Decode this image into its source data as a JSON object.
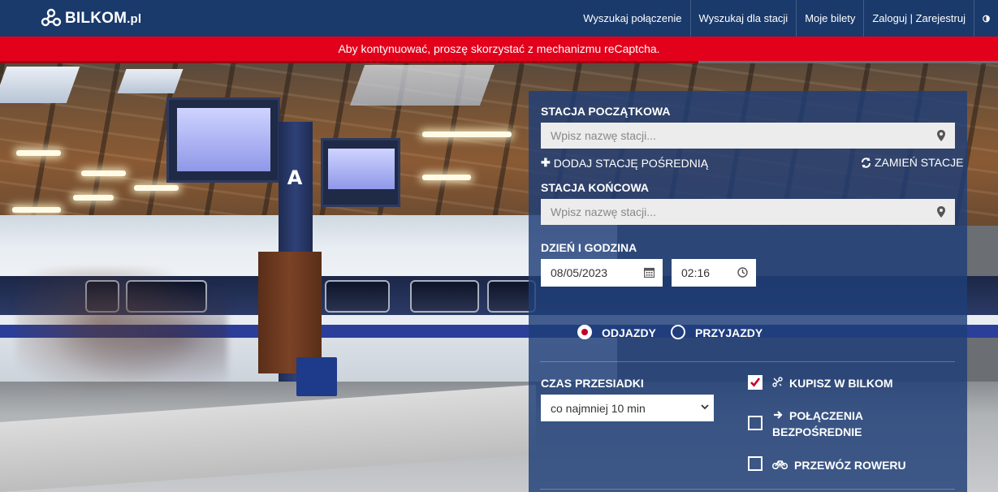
{
  "header": {
    "logo_name": "BILKOM",
    "logo_suffix": ".pl",
    "nav": [
      "Wyszukaj połączenie",
      "Wyszukaj dla stacji",
      "Moje bilety",
      "Zaloguj | Zarejestruj"
    ],
    "contrast_icon": "contrast-icon"
  },
  "alert": {
    "message": "Aby kontynuować, proszę skorzystać z mechanizmu reCaptcha."
  },
  "search": {
    "from_label": "Stacja początkowa",
    "from_placeholder": "Wpisz nazwę stacji...",
    "add_via_label": "Dodaj stację pośrednią",
    "swap_label": "Zamień stacje",
    "to_label": "Stacja końcowa",
    "to_placeholder": "Wpisz nazwę stacji...",
    "datetime_label": "Dzień i godzina",
    "date_value": "08/05/2023",
    "time_value": "02:16",
    "departures_label": "ODJAZDY",
    "arrivals_label": "PRZYJAZDY",
    "selected_direction": "departures",
    "transfer_label": "Czas przesiadki",
    "transfer_value": "co najmniej 10 min",
    "options": [
      {
        "label": "Kupisz w BILKOM",
        "checked": true,
        "icon": "ticket-icon"
      },
      {
        "label_line1": "Połączenia",
        "label_line2": "bezpośrednie",
        "checked": false,
        "icon": "arrow-right-icon"
      },
      {
        "label": "Przewóz roweru",
        "checked": false,
        "icon": "bicycle-icon"
      }
    ]
  },
  "background": {
    "platform_sign": "A"
  },
  "colors": {
    "header_bg": "#1a3a6b",
    "alert_bg": "#e3001b",
    "panel_bg": "#1e3e78",
    "accent_red": "#c4002b"
  }
}
